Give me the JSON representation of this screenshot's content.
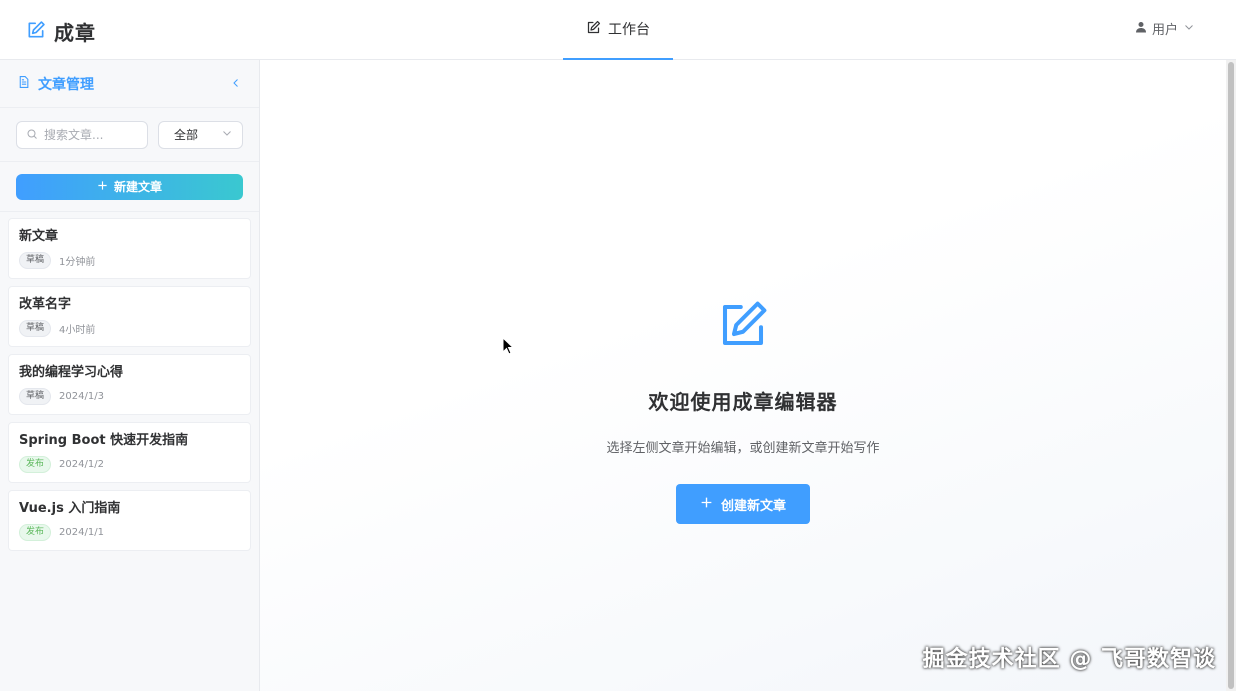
{
  "header": {
    "app_name": "成章",
    "logo_icon": "edit-icon",
    "nav": {
      "label": "工作台",
      "icon": "edit-icon",
      "active": true
    },
    "user": {
      "label": "用户",
      "icon": "user-icon",
      "dropdown_icon": "chevron-down-icon"
    }
  },
  "sidebar": {
    "title": "文章管理",
    "title_icon": "document-icon",
    "collapse_icon": "chevron-left-icon",
    "search": {
      "placeholder": "搜索文章..."
    },
    "filter": {
      "selected": "全部"
    },
    "new_button": "新建文章",
    "articles": [
      {
        "title": "新文章",
        "status": "草稿",
        "time": "1分钟前"
      },
      {
        "title": "改革名字",
        "status": "草稿",
        "time": "4小时前"
      },
      {
        "title": "我的编程学习心得",
        "status": "草稿",
        "time": "2024/1/3"
      },
      {
        "title": "Spring Boot 快速开发指南",
        "status": "发布",
        "time": "2024/1/2"
      },
      {
        "title": "Vue.js 入门指南",
        "status": "发布",
        "time": "2024/1/1"
      }
    ]
  },
  "main": {
    "icon": "edit-icon",
    "title": "欢迎使用成章编辑器",
    "subtitle": "选择左侧文章开始编辑，或创建新文章开始写作",
    "create_button": "创建新文章"
  },
  "watermark": "掘金技术社区 @ 飞哥数智谈",
  "colors": {
    "primary": "#409eff",
    "gradient_end": "#3ac8d0",
    "draft_tag": "#f0f2f5",
    "published_tag": "#e8f8ec"
  }
}
